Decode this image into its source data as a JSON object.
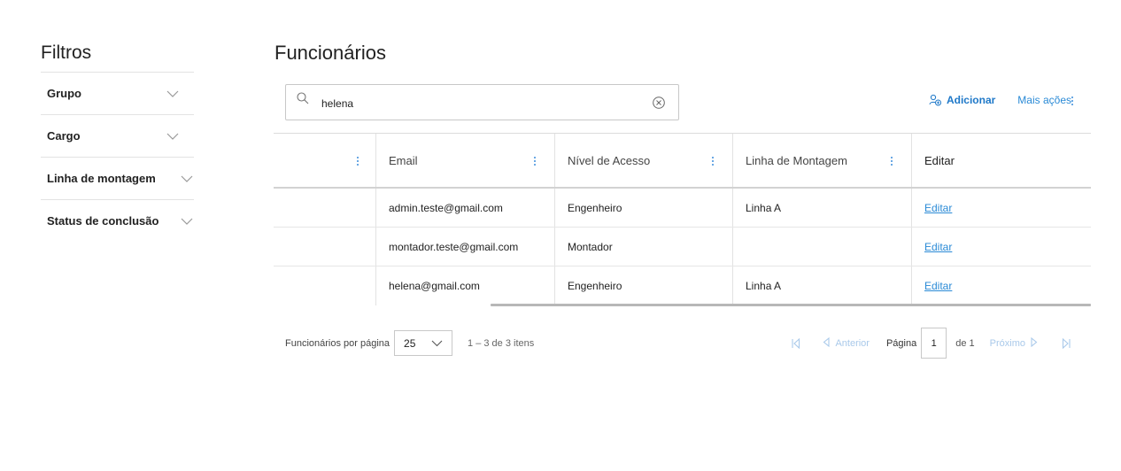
{
  "sidebar": {
    "title": "Filtros",
    "filters": [
      {
        "label": "Grupo"
      },
      {
        "label": "Cargo"
      },
      {
        "label": "Linha de montagem"
      },
      {
        "label": "Status de conclusão"
      }
    ]
  },
  "main": {
    "title": "Funcionários",
    "search": {
      "value": "helena",
      "placeholder": ""
    },
    "actions": {
      "add_label": "Adicionar",
      "more_label": "Mais ações"
    },
    "table": {
      "columns": [
        "",
        "Email",
        "Nível de Acesso",
        "Linha de Montagem",
        "Editar"
      ],
      "rows": [
        {
          "email": "admin.teste@gmail.com",
          "access": "Engenheiro",
          "line": "Linha A",
          "edit": "Editar"
        },
        {
          "email": "montador.teste@gmail.com",
          "access": "Montador",
          "line": "",
          "edit": "Editar"
        },
        {
          "email": "helena@gmail.com",
          "access": "Engenheiro",
          "line": "Linha A",
          "edit": "Editar"
        }
      ]
    },
    "pager": {
      "per_page_label": "Funcionários por página",
      "per_page_value": "25",
      "range": "1 – 3 de 3 itens",
      "prev_label": "Anterior",
      "page_label": "Página",
      "page_value": "1",
      "of_label": "de 1",
      "next_label": "Próximo"
    }
  },
  "colors": {
    "accent": "#1e78c8",
    "link": "#2a8ad6",
    "muted": "#a9c9ea"
  }
}
